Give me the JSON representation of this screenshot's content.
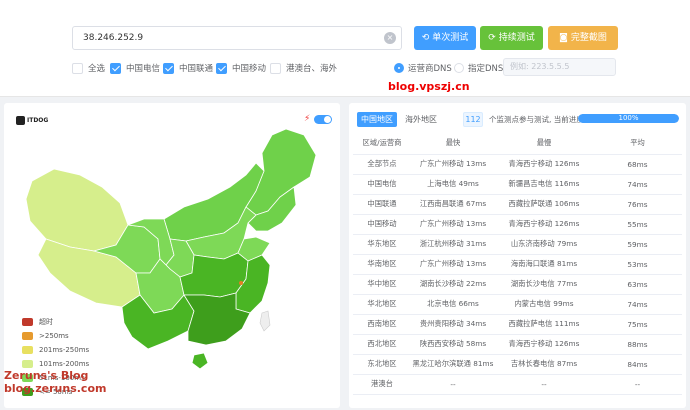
{
  "top": {
    "ip_value": "38.246.252.9",
    "clear_glyph": "×",
    "buttons": {
      "single_label": "单次测试",
      "continuous_label": "持续测试",
      "screenshot_label": "完整截图"
    },
    "filters": [
      {
        "label": "全选",
        "checked": false
      },
      {
        "label": "中国电信",
        "checked": true
      },
      {
        "label": "中国联通",
        "checked": true
      },
      {
        "label": "中国移动",
        "checked": true
      },
      {
        "label": "港澳台、海外",
        "checked": false
      }
    ],
    "dns": {
      "carrier_label": "运营商DNS",
      "custom_label": "指定DNS:",
      "custom_placeholder": "例如: 223.5.5.5"
    },
    "watermark": "blog.vpszj.cn"
  },
  "map": {
    "brand": "ITDOG",
    "bolt_icon": "⚡",
    "legend": [
      {
        "label": "超时",
        "color": "#c0392b"
      },
      {
        "label": ">250ms",
        "color": "#e69a2e"
      },
      {
        "label": "201ms-250ms",
        "color": "#e8e060"
      },
      {
        "label": "101ms-200ms",
        "color": "#d6ee8c"
      },
      {
        "label": "51ms-100ms",
        "color": "#7ed957"
      },
      {
        "label": "<= 50ms",
        "color": "#3e9e1c"
      }
    ],
    "blog_line1": "Zeruns's Blog",
    "blog_line2": "blog.zeruns.com"
  },
  "results": {
    "tabs": [
      "中国地区",
      "海外地区"
    ],
    "count": "112",
    "count_text": "个监测点参与测试, 当前进度:",
    "progress_percent": 100,
    "progress_label": "100%",
    "columns": [
      "区域/运营商",
      "最快",
      "最慢",
      "平均"
    ],
    "rows": [
      [
        "全部节点",
        "广东广州移动 13ms",
        "青海西宁移动 126ms",
        "68ms"
      ],
      [
        "中国电信",
        "上海电信 49ms",
        "新疆昌吉电信 116ms",
        "74ms"
      ],
      [
        "中国联通",
        "江西南昌联通 67ms",
        "西藏拉萨联通 106ms",
        "76ms"
      ],
      [
        "中国移动",
        "广东广州移动 13ms",
        "青海西宁移动 126ms",
        "55ms"
      ],
      [
        "华东地区",
        "浙江杭州移动 31ms",
        "山东济南移动 79ms",
        "59ms"
      ],
      [
        "华南地区",
        "广东广州移动 13ms",
        "海南海口联通 81ms",
        "53ms"
      ],
      [
        "华中地区",
        "湖南长沙移动 22ms",
        "湖南长沙电信 77ms",
        "63ms"
      ],
      [
        "华北地区",
        "北京电信 66ms",
        "内蒙古电信 99ms",
        "74ms"
      ],
      [
        "西南地区",
        "贵州贵阳移动 34ms",
        "西藏拉萨电信 111ms",
        "75ms"
      ],
      [
        "西北地区",
        "陕西西安移动 58ms",
        "青海西宁移动 126ms",
        "88ms"
      ],
      [
        "东北地区",
        "黑龙江哈尔滨联通 81ms",
        "吉林长春电信 87ms",
        "84ms"
      ],
      [
        "港澳台",
        "--",
        "--",
        "--"
      ]
    ]
  }
}
